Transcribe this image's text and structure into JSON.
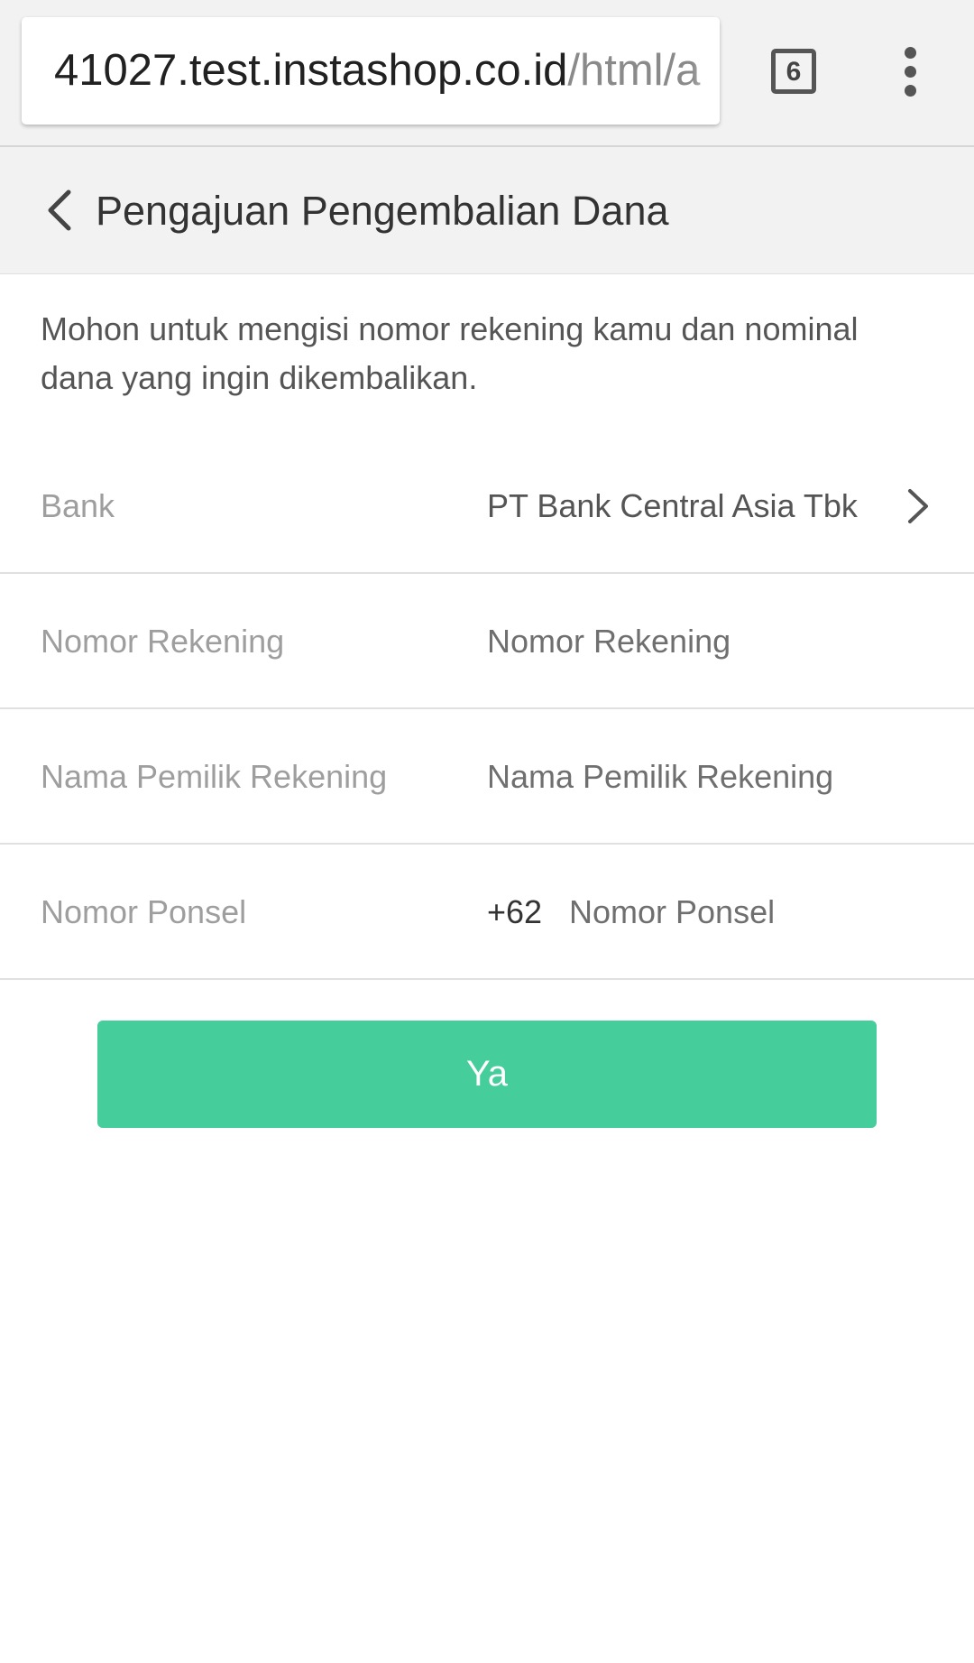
{
  "browser": {
    "url_host": "41027.test.instashop.co.id",
    "url_path": "/html/a",
    "tab_count": "6",
    "menu_icon": "more-vert-icon"
  },
  "header": {
    "back_icon": "chevron-left-icon",
    "title": "Pengajuan Pengembalian Dana"
  },
  "intro": {
    "text": "Mohon untuk mengisi nomor rekening kamu dan nominal dana yang ingin dikembalikan."
  },
  "form": {
    "bank": {
      "label": "Bank",
      "value": "PT Bank Central Asia Tbk",
      "icon": "chevron-right-icon"
    },
    "account_number": {
      "label": "Nomor Rekening",
      "placeholder": "Nomor Rekening",
      "value": ""
    },
    "account_holder": {
      "label": "Nama Pemilik Rekening",
      "placeholder": "Nama Pemilik Rekening",
      "value": ""
    },
    "phone": {
      "label": "Nomor Ponsel",
      "prefix": "+62",
      "placeholder": "Nomor Ponsel",
      "value": ""
    }
  },
  "actions": {
    "submit_label": "Ya"
  },
  "colors": {
    "accent": "#45cd9b",
    "header_bg": "#f2f2f2",
    "divider": "#e0e0e0"
  }
}
